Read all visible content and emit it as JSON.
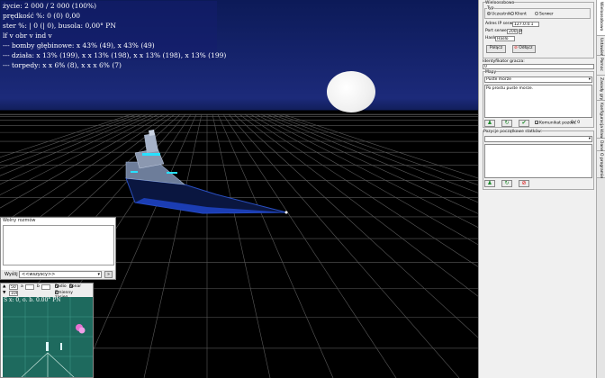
{
  "hud": {
    "lines": [
      "życie: 2 000 / 2 000 (100%)",
      "prędkość %: 0 (0) 0,00",
      "ster %: | 0 (| 0), busola: 0,00° PN",
      "lf v obr v ind v",
      "--- bomby głębinowe: x 43% (49),  x 43% (49)",
      "--- działa: x 13% (199),  x x 13% (198),  x x 13% (198),  x 13% (199)",
      "--- torpedy: x x 6% (8),  x x x 6% (7)"
    ]
  },
  "chat": {
    "title": "Wolny rozmów",
    "send_label": "Wyślij",
    "recipient": "<<wszyscy>>",
    "send_button": "»"
  },
  "radar": {
    "value1": "50",
    "value2": "100",
    "field_a": "a",
    "field_b": "b",
    "radio_label": "Radio",
    "sonar_label": "Sonar",
    "zoom_label": "Zmienny zasięg",
    "readout": "S x: 0, o. b. 0.00° PN"
  },
  "panel": {
    "multiplayer_title": "Wieloosobowo",
    "type_label": "Typ",
    "type_options": [
      "Uczestnik",
      "Klient",
      "Serwer"
    ],
    "server_ip_label": "Adres IP serwera:",
    "server_ip": "127.0.0.1",
    "port_label": "Port serwera:",
    "port": "2000",
    "password_label": "Hasło:",
    "password": "Hasło",
    "connect_button": "Połącz",
    "disconnect_button": "Odłącz",
    "player_id_label": "Identyfikator gracza:",
    "player_id": "0",
    "maps_label": "Mapy",
    "map_selected": "Puste morze",
    "map_description": "Po prostu puste morze.",
    "comment_checkbox_label": "Komunikat pozost.",
    "comment_value": "0 / 0",
    "positions_label": "Pozycje początkowe statków:"
  },
  "tabs": [
    "Wieloosobowo",
    "Ustawienia",
    "Pomoc",
    "Zasady gry",
    "Konfiguracja klawiszy",
    "Dane",
    "O programie"
  ]
}
